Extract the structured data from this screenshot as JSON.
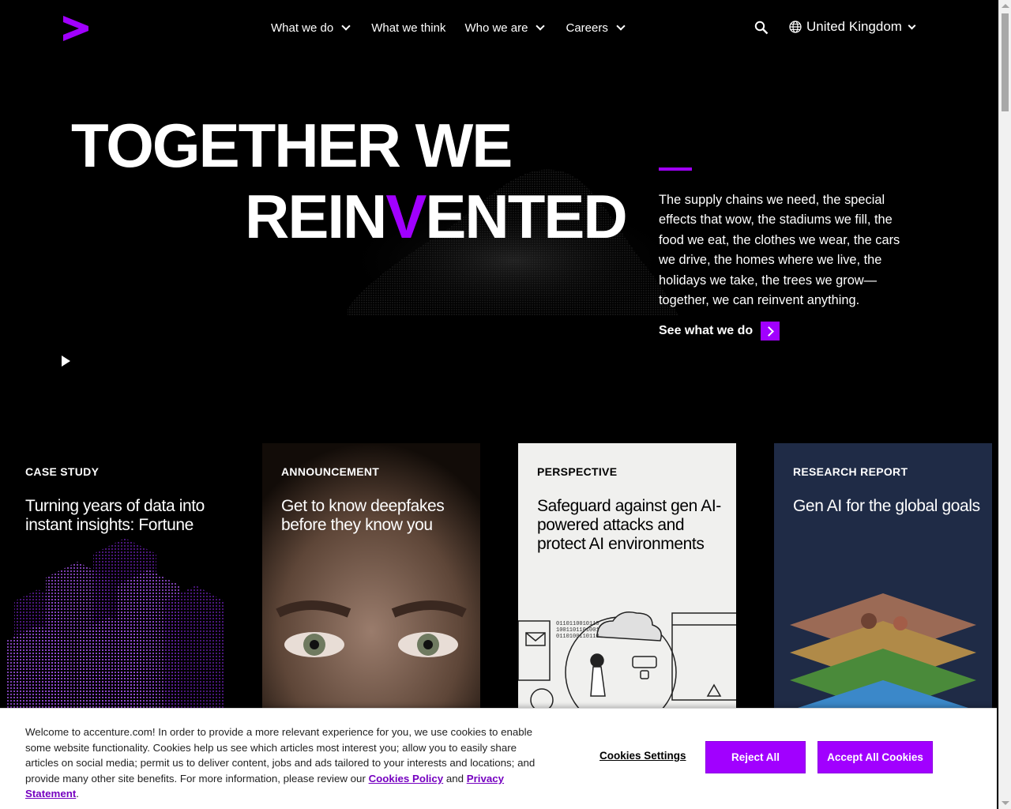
{
  "header": {
    "nav": [
      {
        "label": "What we do",
        "dropdown": true
      },
      {
        "label": "What we think",
        "dropdown": false
      },
      {
        "label": "Who we are",
        "dropdown": true
      },
      {
        "label": "Careers",
        "dropdown": true
      }
    ],
    "locale": "United Kingdom",
    "icons": {
      "logo": "accenture-logo-icon",
      "search": "search-icon",
      "globe": "globe-icon"
    }
  },
  "hero": {
    "line1": "TOGETHER WE",
    "line2_a": "REIN",
    "line2_v": "V",
    "line2_b": "ENTED",
    "copy": "The supply chains we need, the special effects that wow, the stadiums we fill, the food we eat, the clothes we wear, the cars we drive, the homes where we live, the holidays we take, the trees we grow—together, we can reinvent anything.",
    "cta": "See what we do"
  },
  "cards": [
    {
      "tag": "CASE STUDY",
      "title": "Turning years of data into instant insights: Fortune"
    },
    {
      "tag": "ANNOUNCEMENT",
      "title": "Get to know deepfakes before they know you"
    },
    {
      "tag": "PERSPECTIVE",
      "title": "Safeguard against gen AI-powered attacks and protect AI environments"
    },
    {
      "tag": "RESEARCH REPORT",
      "title": "Gen AI for the global goals"
    }
  ],
  "cookie": {
    "text": "Welcome to accenture.com! In order to provide a more relevant experience for you, we use cookies to enable some website functionality. Cookies help us see which articles most interest you; allow you to easily share articles on social media; permit us to deliver content, jobs and ads tailored to your interests and locations; and provide many other site benefits. For more information, please review our ",
    "link1": "Cookies Policy",
    "and": " and ",
    "link2": "Privacy Statement",
    "end": ".",
    "settings": "Cookies Settings",
    "reject": "Reject All",
    "accept": "Accept All Cookies"
  },
  "colors": {
    "accent": "#a100ff",
    "background": "#000000",
    "card4": "#1f2b46",
    "card3": "#f0f0ee"
  }
}
